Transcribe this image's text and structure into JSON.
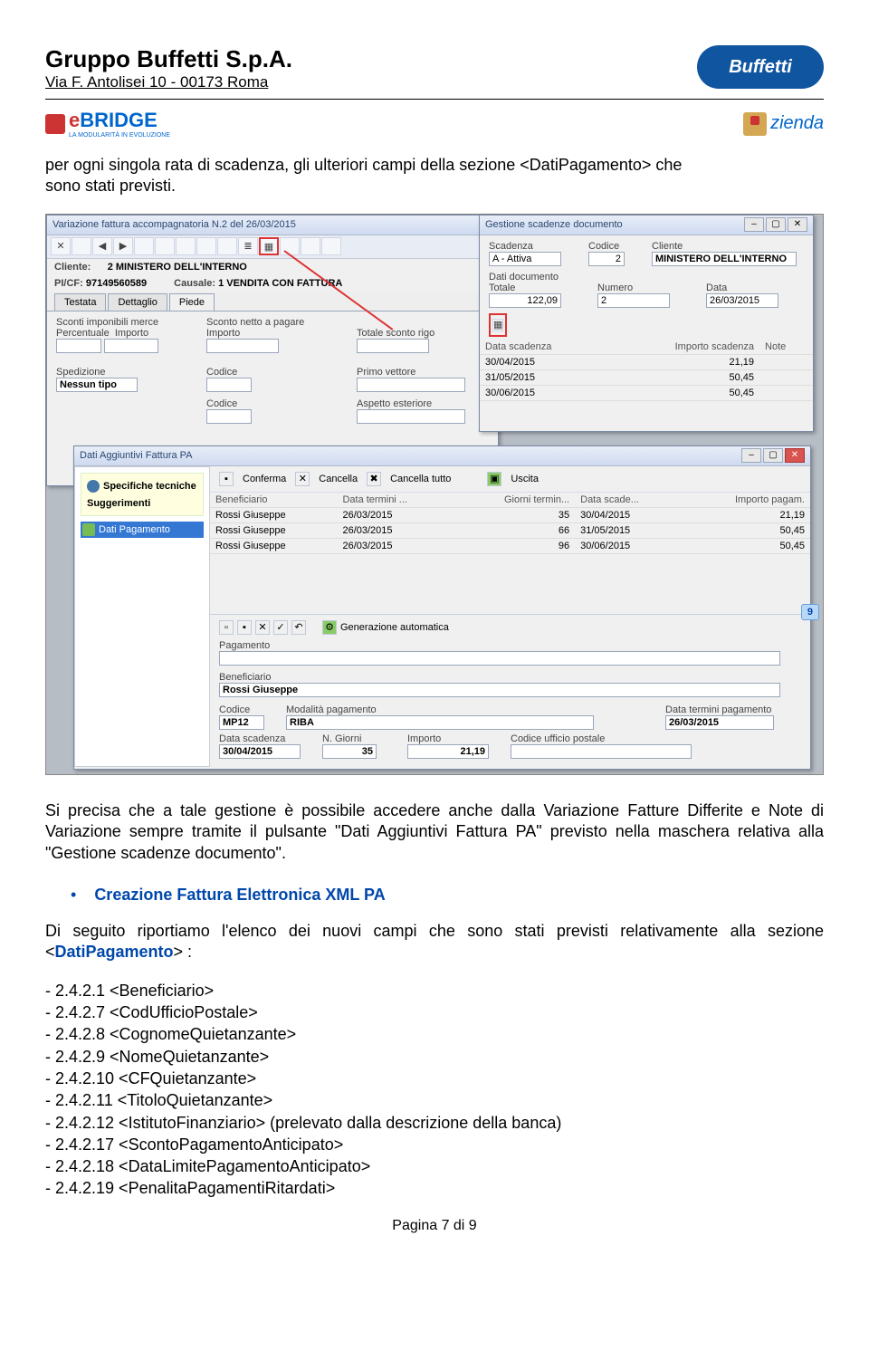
{
  "header": {
    "company": "Gruppo Buffetti S.p.A.",
    "address": "Via F. Antolisei 10 - 00173 Roma",
    "buffetti_logo": "Buffetti"
  },
  "ebridge": {
    "prefix": "e",
    "brand": "BRIDGE",
    "tagline": "LA MODULARITÀ IN EVOLUZIONE"
  },
  "azienda": {
    "label": "zienda"
  },
  "para1a": "per ogni singola rata di scadenza, gli ulteriori campi della sezione <DatiPagamento> che",
  "para1b": "sono stati previsti.",
  "win1": {
    "title": "Variazione fattura accompagnatoria N.2 del 26/03/2015",
    "cliente_lbl": "Cliente:",
    "cliente_val": "2 MINISTERO DELL'INTERNO",
    "picf_lbl": "PI/CF:",
    "picf_val": "97149560589",
    "causale_lbl": "Causale:",
    "causale_val": "1 VENDITA CON FATTURA",
    "tabs": [
      "Testata",
      "Dettaglio",
      "Piede"
    ],
    "s1_title": "Sconti imponibili merce",
    "s1_a": "Percentuale",
    "s1_b": "Importo",
    "s2_title": "Sconto netto a pagare",
    "s2_a": "Importo",
    "s3": "Totale sconto rigo",
    "spedizione": "Spedizione",
    "nessun": "Nessun tipo",
    "codice": "Codice",
    "primov": "Primo vettore",
    "aspetto": "Aspetto esteriore"
  },
  "win2": {
    "title": "Gestione scadenze documento",
    "scadenza": "Scadenza",
    "attiva": "A - Attiva",
    "codice": "Codice",
    "codice_val": "2",
    "cliente": "Cliente",
    "cliente_val": "MINISTERO DELL'INTERNO",
    "dati_doc": "Dati documento",
    "totale": "Totale",
    "totale_val": "122,09",
    "numero": "Numero",
    "numero_val": "2",
    "data": "Data",
    "data_val": "26/03/2015",
    "th": [
      "Data scadenza",
      "Importo scadenza",
      "Note"
    ],
    "rows": [
      [
        "30/04/2015",
        "21,19",
        ""
      ],
      [
        "31/05/2015",
        "50,45",
        ""
      ],
      [
        "30/06/2015",
        "50,45",
        ""
      ]
    ]
  },
  "win3": {
    "title": "Dati Aggiuntivi Fattura PA",
    "left_items": [
      "Specifiche tecniche",
      "Suggerimenti"
    ],
    "left_active": "Dati Pagamento",
    "tb": {
      "conferma": "Conferma",
      "cancella": "Cancella",
      "cantutto": "Cancella tutto",
      "uscita": "Uscita"
    },
    "th": [
      "Beneficiario",
      "Data termini ...",
      "Giorni termin...",
      "Data scade...",
      "Importo pagam."
    ],
    "rows": [
      [
        "Rossi Giuseppe",
        "26/03/2015",
        "35",
        "30/04/2015",
        "21,19"
      ],
      [
        "Rossi Giuseppe",
        "26/03/2015",
        "66",
        "31/05/2015",
        "50,45"
      ],
      [
        "Rossi Giuseppe",
        "26/03/2015",
        "96",
        "30/06/2015",
        "50,45"
      ]
    ],
    "gen": "Generazione automatica",
    "pag": "Pagamento",
    "benef": "Beneficiario",
    "benef_val": "Rossi Giuseppe",
    "codice": "Codice",
    "codice_val": "MP12",
    "modal": "Modalità pagamento",
    "modal_val": "RIBA",
    "dtp": "Data termini pagamento",
    "dtp_val": "26/03/2015",
    "ds": "Data scadenza",
    "ds_val": "30/04/2015",
    "ng": "N. Giorni",
    "ng_val": "35",
    "imp": "Importo",
    "imp_val": "21,19",
    "cup": "Codice ufficio postale"
  },
  "para2": "Si precisa che a tale gestione è possibile accedere anche dalla Variazione Fatture Differite e Note di Variazione sempre tramite il pulsante \"Dati Aggiuntivi Fattura PA\" previsto nella maschera relativa alla \"Gestione scadenze documento\".",
  "bullet": "Creazione Fattura Elettronica XML PA",
  "para3a": "Di seguito riportiamo l'elenco dei nuovi campi che sono stati previsti relativamente alla",
  "para3b": "sezione <",
  "para3c": "DatiPagamento",
  "para3d": "> :",
  "list": [
    "- 2.4.2.1    <Beneficiario>",
    "- 2.4.2.7    <CodUfficioPostale>",
    "- 2.4.2.8    <CognomeQuietanzante>",
    "- 2.4.2.9     <NomeQuietanzante>",
    "- 2.4.2.10    <CFQuietanzante>",
    "- 2.4.2.11   <TitoloQuietanzante>",
    "- 2.4.2.12   <IstitutoFinanziario> (prelevato dalla descrizione della banca)",
    "- 2.4.2.17   <ScontoPagamentoAnticipato>",
    "- 2.4.2.18   <DataLimitePagamentoAnticipato>",
    "- 2.4.2.19   <PenalitaPagamentiRitardati>"
  ],
  "footer": "Pagina 7 di 9"
}
